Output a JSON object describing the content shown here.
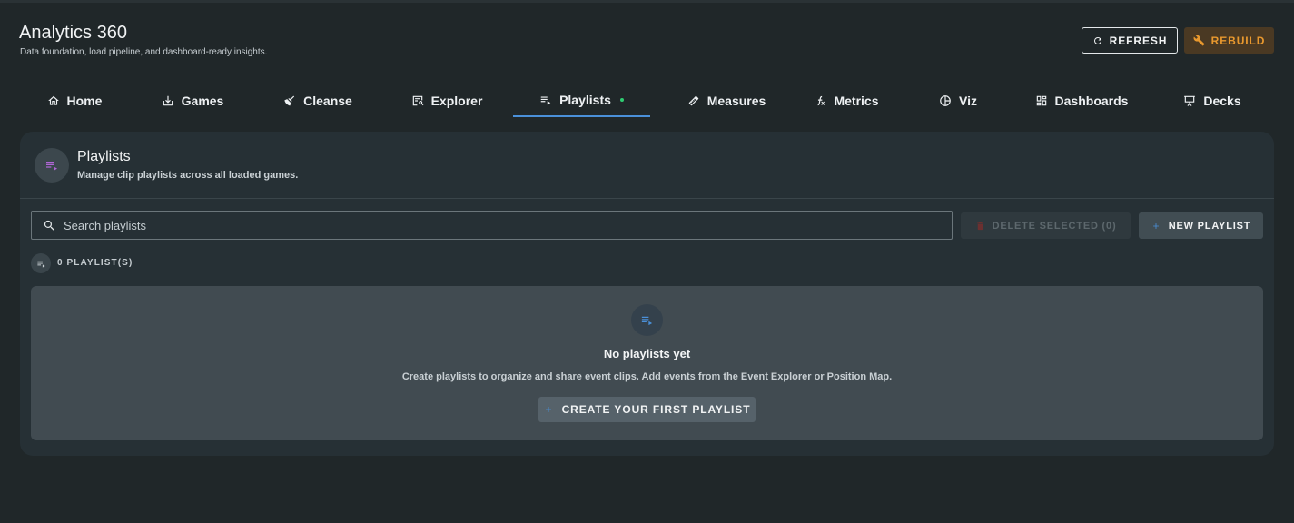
{
  "app": {
    "title": "Analytics 360",
    "subtitle": "Data foundation, load pipeline, and dashboard-ready insights."
  },
  "header_actions": {
    "refresh_label": "REFRESH",
    "rebuild_label": "REBUILD"
  },
  "tabs": [
    {
      "label": "Home",
      "icon": "home-icon"
    },
    {
      "label": "Games",
      "icon": "download-icon"
    },
    {
      "label": "Cleanse",
      "icon": "broom-icon"
    },
    {
      "label": "Explorer",
      "icon": "table-search-icon"
    },
    {
      "label": "Playlists",
      "icon": "playlist-icon",
      "active": true,
      "status_dot": true
    },
    {
      "label": "Measures",
      "icon": "ruler-icon"
    },
    {
      "label": "Metrics",
      "icon": "function-icon"
    },
    {
      "label": "Viz",
      "icon": "pie-chart-icon"
    },
    {
      "label": "Dashboards",
      "icon": "dashboard-icon"
    },
    {
      "label": "Decks",
      "icon": "presentation-icon"
    }
  ],
  "panel": {
    "title": "Playlists",
    "subtitle": "Manage clip playlists across all loaded games.",
    "search_placeholder": "Search playlists",
    "delete_label": "DELETE SELECTED (0)",
    "new_label": "NEW PLAYLIST",
    "count_label": "0 PLAYLIST(S)"
  },
  "empty_state": {
    "title": "No playlists yet",
    "text": "Create playlists to organize and share event clips. Add events from the Event Explorer or Position Map.",
    "button_label": "CREATE YOUR FIRST PLAYLIST"
  },
  "colors": {
    "background": "#202729",
    "card": "#263035",
    "accent": "#4a90d9",
    "warning": "#e8982e",
    "status_dot": "#2ecc71",
    "playlist_icon": "#b066d6"
  }
}
